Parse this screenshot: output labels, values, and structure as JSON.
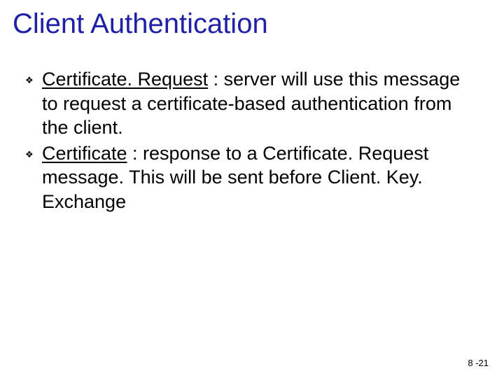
{
  "title": "Client Authentication",
  "bullets": [
    {
      "term": "Certificate. Request",
      "rest": " : server will use this message to request a certificate-based authentication from the client."
    },
    {
      "term": "Certificate",
      "rest": " : response to a Certificate. Request message. This will be sent before Client. Key. Exchange"
    }
  ],
  "footer": "8 -21",
  "icons": {
    "diamond": "❖"
  }
}
